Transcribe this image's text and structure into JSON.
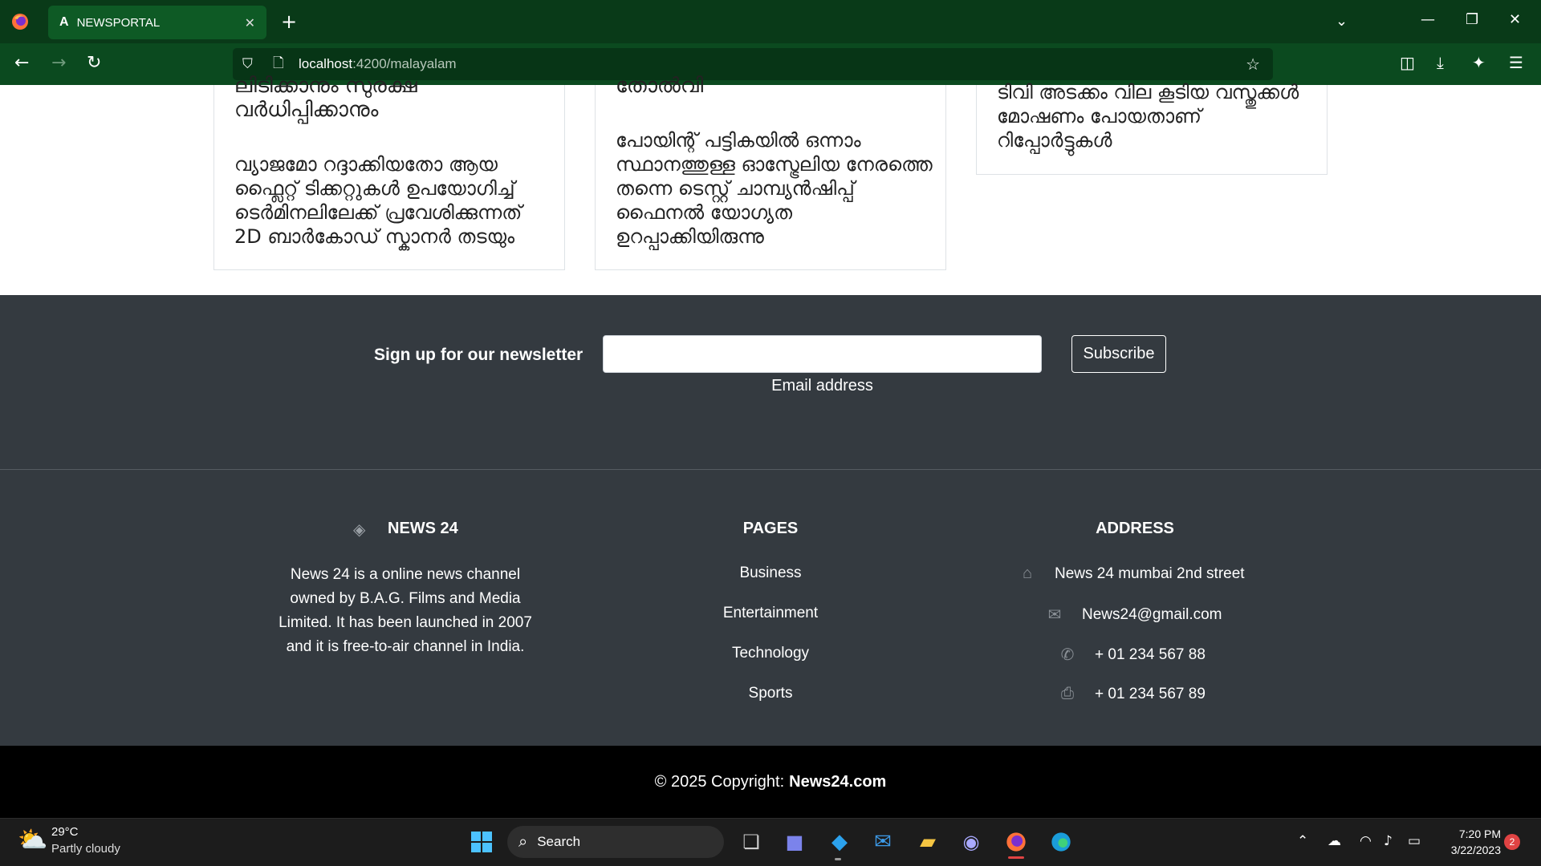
{
  "browser": {
    "tab_title": "NEWSPORTAL",
    "tab_icon": "A",
    "url_host": "localhost",
    "url_path": ":4200/malayalam"
  },
  "articles": [
    {
      "title_lines": "ലിടിക്കാനും സുരക്ഷ\nവർധിപ്പിക്കാനും",
      "body": "വ്യാജമോ റദ്ദാക്കിയതോ ആയ ഫ്ലൈറ്റ് ടിക്കറ്റുകൾ ഉപയോഗിച്ച് ടെർമിനലിലേക്ക് പ്രവേശിക്കുന്നത് 2D ബാർകോഡ് സ്കാനർ തടയും"
    },
    {
      "title_lines": "തോൽവി",
      "body": "പോയിന്റ് പട്ടികയിൽ ഒന്നാം സ്ഥാനത്തുള്ള ഓസ്ട്രേലിയ നേരത്തെ തന്നെ ടെസ്റ്റ് ചാമ്പ്യൻഷിപ്പ് ഫൈനൽ യോഗ്യത ഉറപ്പാക്കിയിരുന്നു"
    },
    {
      "title_lines": "",
      "body": "ടിവി അടക്കം വില കൂടിയ വസ്തുക്കൾ മോഷണം പോയതാണ് റിപ്പോർട്ടുകൾ"
    }
  ],
  "newsletter": {
    "label": "Sign up for our newsletter",
    "input_value": "",
    "help_text": "Email address",
    "button": "Subscribe"
  },
  "footer": {
    "brand": "NEWS 24",
    "about": "News 24 is a online news channel owned by B.A.G. Films and Media Limited. It has been launched in 2007 and it is free-to-air channel in India.",
    "pages_heading": "PAGES",
    "pages": [
      "Business",
      "Entertainment",
      "Technology",
      "Sports"
    ],
    "address_heading": "ADDRESS",
    "address": [
      {
        "icon": "home-icon",
        "text": "News 24 mumbai 2nd street"
      },
      {
        "icon": "envelope-icon",
        "text": "News24@gmail.com"
      },
      {
        "icon": "phone-icon",
        "text": "+ 01 234 567 88"
      },
      {
        "icon": "print-icon",
        "text": "+ 01 234 567 89"
      }
    ],
    "copyright_prefix": "© 2025 Copyright:",
    "copyright_site": "News24.com"
  },
  "taskbar": {
    "weather_temp": "29°C",
    "weather_desc": "Partly cloudy",
    "search_label": "Search",
    "time": "7:20 PM",
    "date": "3/22/2023",
    "notification_count": "2"
  },
  "colors": {
    "browser_chrome": "#0b4a1f",
    "footer_bg": "#343a40",
    "copyright_bg": "#000000"
  }
}
